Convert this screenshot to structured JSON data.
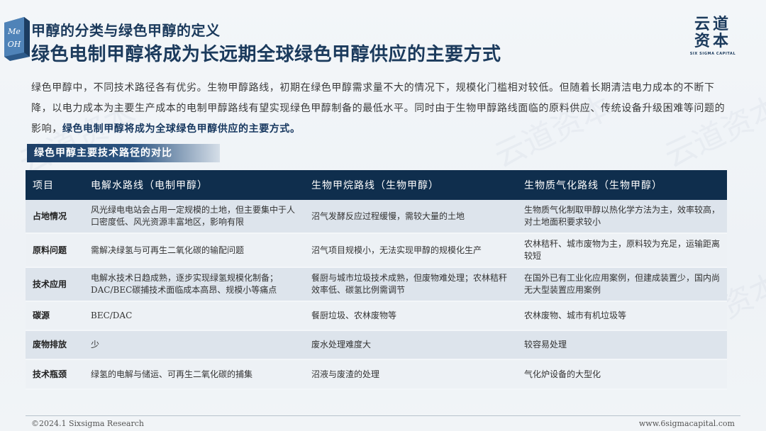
{
  "header": {
    "subtitle": "甲醇的分类与绿色甲醇的定义",
    "title": "绿色电制甲醇将成为长远期全球绿色甲醇供应的主要方式",
    "cube_text": [
      "Me",
      "OH"
    ]
  },
  "brand": {
    "cn_line1": "云道",
    "cn_line2": "资本",
    "en": "SIX SIGMA CAPITAL"
  },
  "intro": {
    "text": "绿色甲醇中，不同技术路径各有优劣。生物甲醇路线，初期在绿色甲醇需求量不大的情况下，规模化门槛相对较低。但随着长期清洁电力成本的不断下降，以电力成本为主要生产成本的电制甲醇路线有望实现绿色甲醇制备的最低水平。同时由于生物甲醇路线面临的原料供应、传统设备升级困难等问题的影响，",
    "highlight": "绿色电制甲醇将成为全球绿色甲醇供应的主要方式。"
  },
  "section_tag": "绿色甲醇主要技术路径的对比",
  "table": {
    "headers": [
      "项目",
      "电解水路线（电制甲醇）",
      "生物甲烷路线（生物甲醇）",
      "生物质气化路线（生物甲醇）"
    ],
    "rows": [
      [
        "占地情况",
        "风光绿电电站会占用一定规模的土地，但主要集中于人口密度低、风光资源丰富地区，影响有限",
        "沼气发酵反应过程缓慢，需较大量的土地",
        "生物质气化制取甲醇以热化学方法为主，效率较高，对土地面积要求较小"
      ],
      [
        "原料问题",
        "需解决绿氢与可再生二氧化碳的输配问题",
        "沼气项目规模小，无法实现甲醇的规模化生产",
        "农林秸秆、城市废物为主，原料较为充足，运输距离较短"
      ],
      [
        "技术应用",
        "电解水技术日趋成熟，逐步实现绿氢规模化制备；DAC/BEC碳捕技术面临成本高昂、规模小等痛点",
        "餐厨与城市垃圾技术成熟，但废物难处理；农林秸秆效率低、碳氢比例需调节",
        "在国外已有工业化应用案例，但建成装置少，国内尚无大型装置应用案例"
      ],
      [
        "碳源",
        "BEC/DAC",
        "餐厨垃圾、农林废物等",
        "农林废物、城市有机垃圾等"
      ],
      [
        "废物排放",
        "少",
        "废水处理难度大",
        "较容易处理"
      ],
      [
        "技术瓶颈",
        "绿氢的电解与储运、可再生二氧化碳的捕集",
        "沼液与废渣的处理",
        "气化炉设备的大型化"
      ]
    ]
  },
  "footer": {
    "left": "©2024.1 Sixsigma Research",
    "right": "www.6sigmacapital.com"
  },
  "colors": {
    "navy": "#0f2e4d",
    "title": "#1b3a5c",
    "row_dark": "#dde4ec",
    "row_light": "#edf1f5"
  }
}
